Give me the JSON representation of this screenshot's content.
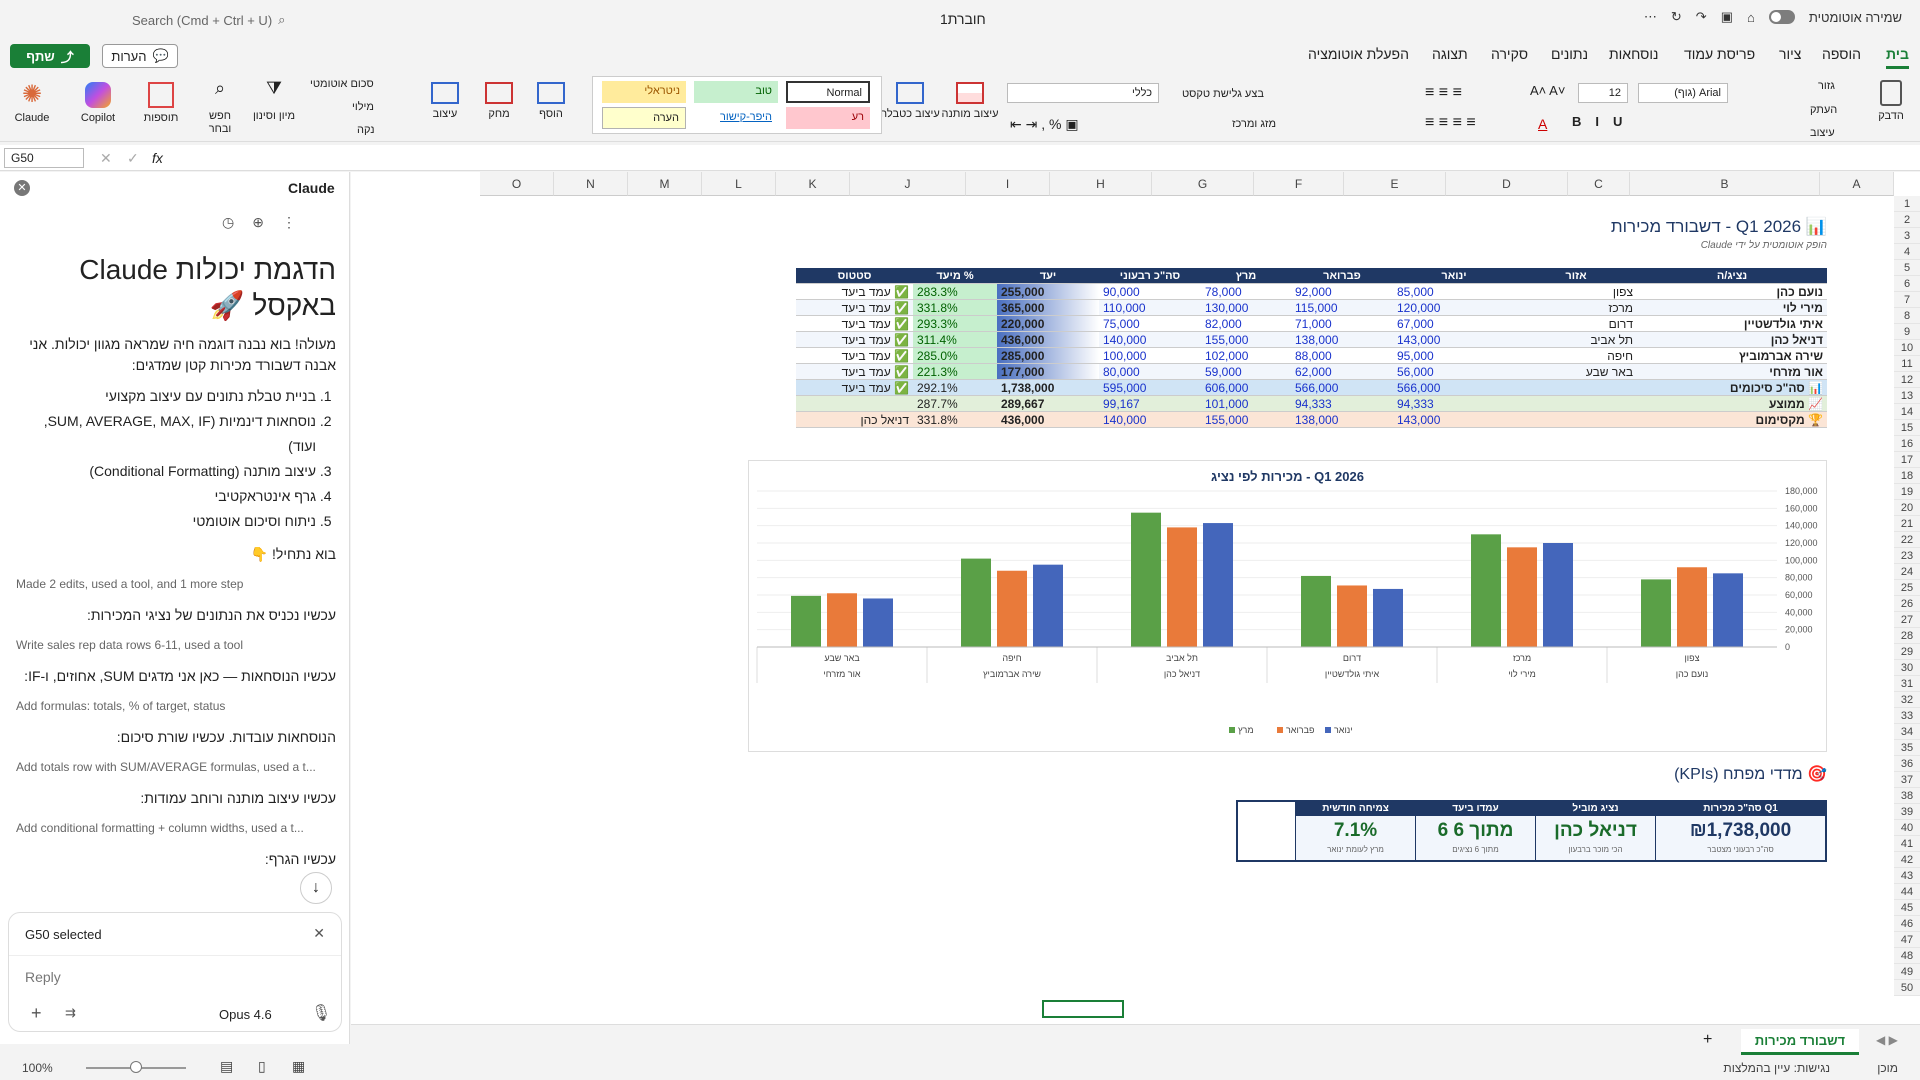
{
  "titlebar": {
    "search": "Search (Cmd + Ctrl + U)",
    "doc_title": "חוברת1",
    "autosave": "שמירה אוטומטית"
  },
  "tabs": [
    "בית",
    "הוספה",
    "ציור",
    "פריסת עמוד",
    "נוסחאות",
    "נתונים",
    "סקירה",
    "תצוגה",
    "הפעלת אוטומציה"
  ],
  "share": "שתף",
  "comments": "הערות",
  "ribbon": {
    "paste": "הדבק",
    "cut": "גזור",
    "copy": "העתק",
    "format": "עיצוב",
    "font_name": "(גוף) Arial",
    "font_size": "12",
    "wrap": "בצע גלישת טקסט",
    "merge": "מזג ומרכז",
    "number_format": "כללי",
    "cond_format": "עיצוב מותנה",
    "format_table": "עיצוב כטבלה",
    "styles": {
      "normal": "Normal",
      "good": "טוב",
      "neutral": "ניטראלי",
      "bad": "רע",
      "hyperlink": "היפר-קישור",
      "note": "הערה"
    },
    "insert": "הוסף",
    "delete": "מחק",
    "format2": "עיצוב",
    "autosum": "סכום אוטומטי",
    "fill": "מילוי",
    "clear": "נקה",
    "sort_filter": "מיון וסינון",
    "find": "חפש ובחר",
    "addins": "תוספות",
    "copilot": "Copilot",
    "claude": "Claude"
  },
  "formula": {
    "namebox": "G50",
    "fx": "fx"
  },
  "panel": {
    "title": "Claude",
    "heading": "הדגמת יכולות Claude באקסל 🚀",
    "intro": "מעולה! בוא נבנה דוגמה חיה שמראה מגוון יכולות. אני אבנה דשבורד מכירות קטן שמדגים:",
    "list": [
      "בניית טבלת נתונים עם עיצוב מקצועי",
      "נוסחאות דינמיות (SUM, AVERAGE, MAX, IF, ועוד)",
      "עיצוב מותנה (Conditional Formatting)",
      "גרף אינטראקטיבי",
      "ניתוח וסיכום אוטומטי"
    ],
    "lets_start": "בוא נתחיל! 👇",
    "steps": [
      {
        "tool": "Made 2 edits, used a tool, and 1 more step",
        "msg": "עכשיו נכניס את הנתונים של נציגי המכירות:"
      },
      {
        "tool": "Write sales rep data rows 6-11, used a tool",
        "msg": "עכשיו הנוסחאות — כאן אני מדגים SUM, אחוזים, ו-IF:"
      },
      {
        "tool": "Add formulas: totals, % of target, status",
        "msg": "הנוסחאות עובדות. עכשיו שורת סיכום:"
      },
      {
        "tool": "Add totals row with SUM/AVERAGE formulas, used a t...",
        "msg": "עכשיו עיצוב מותנה ורוחב עמודות:"
      },
      {
        "tool": "Add conditional formatting + column widths, used a t...",
        "msg": "עכשיו הגרף:"
      }
    ],
    "selected": "G50 selected",
    "reply_placeholder": "Reply",
    "model": "Opus 4.6"
  },
  "columns": [
    "A",
    "B",
    "C",
    "D",
    "E",
    "F",
    "G",
    "H",
    "I",
    "J",
    "K",
    "L",
    "M",
    "N",
    "O"
  ],
  "dashboard": {
    "title": "📊 Q1 2026 - דשבורד מכירות",
    "subtitle": "הופק אוטומטית על ידי Claude",
    "headers": [
      "נציג/ה",
      "אזור",
      "ינואר",
      "פברואר",
      "מרץ",
      "סה\"כ רבעוני",
      "יעד",
      "% מיעד",
      "סטטוס"
    ],
    "rows": [
      [
        "נועם כהן",
        "צפון",
        "85,000",
        "92,000",
        "78,000",
        "90,000",
        "255,000",
        "283.3%",
        "✅ עמד ביעד"
      ],
      [
        "מירי לוי",
        "מרכז",
        "120,000",
        "115,000",
        "130,000",
        "110,000",
        "365,000",
        "331.8%",
        "✅ עמד ביעד"
      ],
      [
        "איתי גולדשטיין",
        "דרום",
        "67,000",
        "71,000",
        "82,000",
        "75,000",
        "220,000",
        "293.3%",
        "✅ עמד ביעד"
      ],
      [
        "דניאל כהן",
        "תל אביב",
        "143,000",
        "138,000",
        "155,000",
        "140,000",
        "436,000",
        "311.4%",
        "✅ עמד ביעד"
      ],
      [
        "שירה אברמוביץ",
        "חיפה",
        "95,000",
        "88,000",
        "102,000",
        "100,000",
        "285,000",
        "285.0%",
        "✅ עמד ביעד"
      ],
      [
        "אור מזרחי",
        "באר שבע",
        "56,000",
        "62,000",
        "59,000",
        "80,000",
        "177,000",
        "221.3%",
        "✅ עמד ביעד"
      ]
    ],
    "summary": [
      [
        "📊 סה\"כ סיכומים",
        "",
        "566,000",
        "566,000",
        "606,000",
        "595,000",
        "1,738,000",
        "292.1%",
        "✅ עמד ביעד"
      ],
      [
        "📈 ממוצע",
        "",
        "94,333",
        "94,333",
        "101,000",
        "99,167",
        "289,667",
        "287.7%",
        ""
      ],
      [
        "🏆 מקסימום",
        "",
        "143,000",
        "138,000",
        "155,000",
        "140,000",
        "436,000",
        "331.8%",
        "דניאל כהן"
      ]
    ]
  },
  "chart_data": {
    "type": "bar",
    "title": "מכירות לפי נציג - Q1 2026",
    "categories": [
      "צפון",
      "מרכז",
      "דרום",
      "תל אביב",
      "חיפה",
      "באר שבע"
    ],
    "category_reps": [
      "נועם כהן",
      "מירי לוי",
      "איתי גולדשטיין",
      "דניאל כהן",
      "שירה אברמוביץ",
      "אור מזרחי"
    ],
    "series": [
      {
        "name": "ינואר",
        "values": [
          85000,
          120000,
          67000,
          143000,
          95000,
          56000
        ],
        "color": "#4466bb"
      },
      {
        "name": "פברואר",
        "values": [
          92000,
          115000,
          71000,
          138000,
          88000,
          62000
        ],
        "color": "#e97a3a"
      },
      {
        "name": "מרץ",
        "values": [
          78000,
          130000,
          82000,
          155000,
          102000,
          59000
        ],
        "color": "#5aa047"
      }
    ],
    "ylim": [
      0,
      180000
    ],
    "yticks": [
      "0",
      "20,000",
      "40,000",
      "60,000",
      "80,000",
      "100,000",
      "120,000",
      "140,000",
      "160,000",
      "180,000"
    ],
    "legend": "bottom"
  },
  "kpi": {
    "title": "🎯 מדדי מפתח (KPIs)",
    "cards": [
      {
        "label": "סה\"כ מכירות Q1",
        "value": "₪1,738,000",
        "sub": "סה\"כ רבעוני מצטבר"
      },
      {
        "label": "נציג מוביל",
        "value": "דניאל כהן",
        "sub": "הכי מוכר ברבעון"
      },
      {
        "label": "עמדו ביעד",
        "value": "6 מתוך 6",
        "sub": "מתוך 6 נציגים"
      },
      {
        "label": "צמיחה חודשית",
        "value": "7.1%",
        "sub": "מרץ לעומת ינואר"
      }
    ]
  },
  "sheet_tab": "דשבורד מכירות",
  "status": {
    "ready": "מוכן",
    "accessibility": "נגישות: עיין בהמלצות",
    "zoom": "100%"
  }
}
